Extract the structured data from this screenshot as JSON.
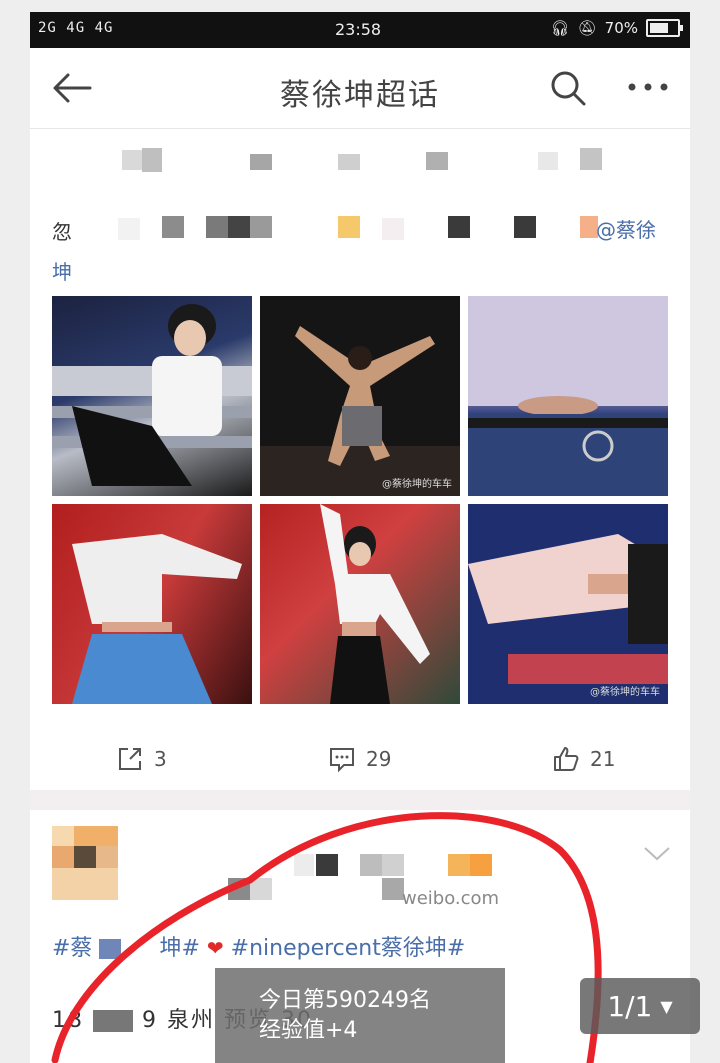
{
  "status_bar": {
    "signal": "2G 4G 4G",
    "time": "23:58",
    "battery": "70%"
  },
  "header": {
    "title": "蔡徐坤超话"
  },
  "post1": {
    "text_start": "忽",
    "mention": "@蔡徐",
    "mention_wrap": "坤",
    "watermark_1": "@蔡徐坤的车车",
    "watermark_2": "@蔡徐坤的车车",
    "actions": {
      "repost_count": "3",
      "comment_count": "29",
      "like_count": "21"
    }
  },
  "post2": {
    "source": "weibo.com",
    "tag_1": "#蔡",
    "tag_1_end": "坤#",
    "tag_2": "#ninepercent蔡徐坤#",
    "date_prefix": "18",
    "date_suffix": "9 泉州 预览 30"
  },
  "toast": {
    "line1": "今日第590249名",
    "line2": "经验值+4"
  },
  "page_indicator": {
    "label": "1/1"
  },
  "colors": {
    "link": "#4a6ea9",
    "annotation": "#e8232a"
  }
}
